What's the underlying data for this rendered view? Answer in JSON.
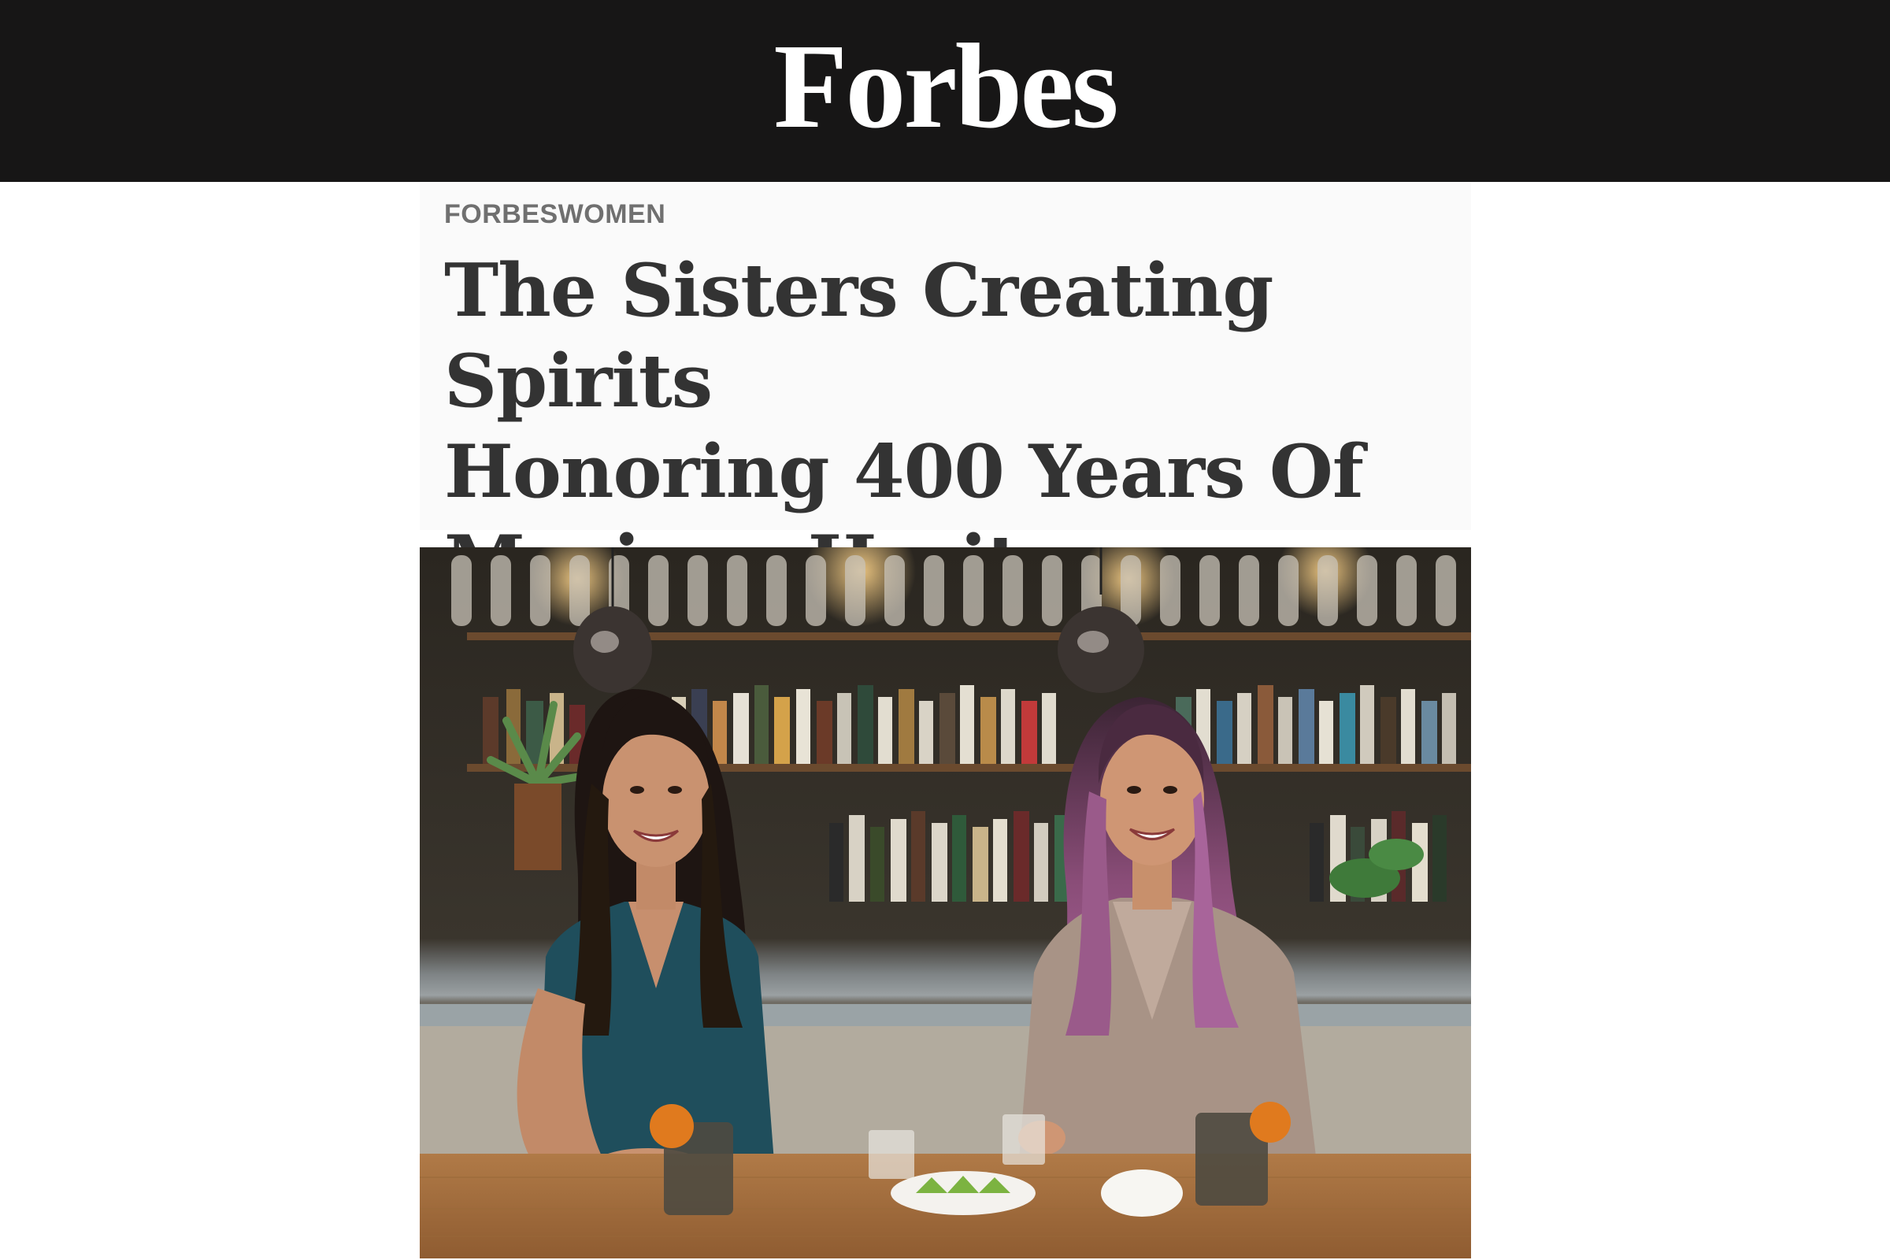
{
  "header": {
    "logo_text": "Forbes",
    "background_color": "#171616"
  },
  "article": {
    "kicker": "FORBESWOMEN",
    "headline_lines": [
      "The Sisters Creating Spirits",
      "Honoring 400 Years Of",
      "Mexican Heritage"
    ],
    "kicker_color": "#707070",
    "headline_color": "#333333"
  },
  "hero_image": {
    "subject": "two-women-at-bar-photo"
  }
}
